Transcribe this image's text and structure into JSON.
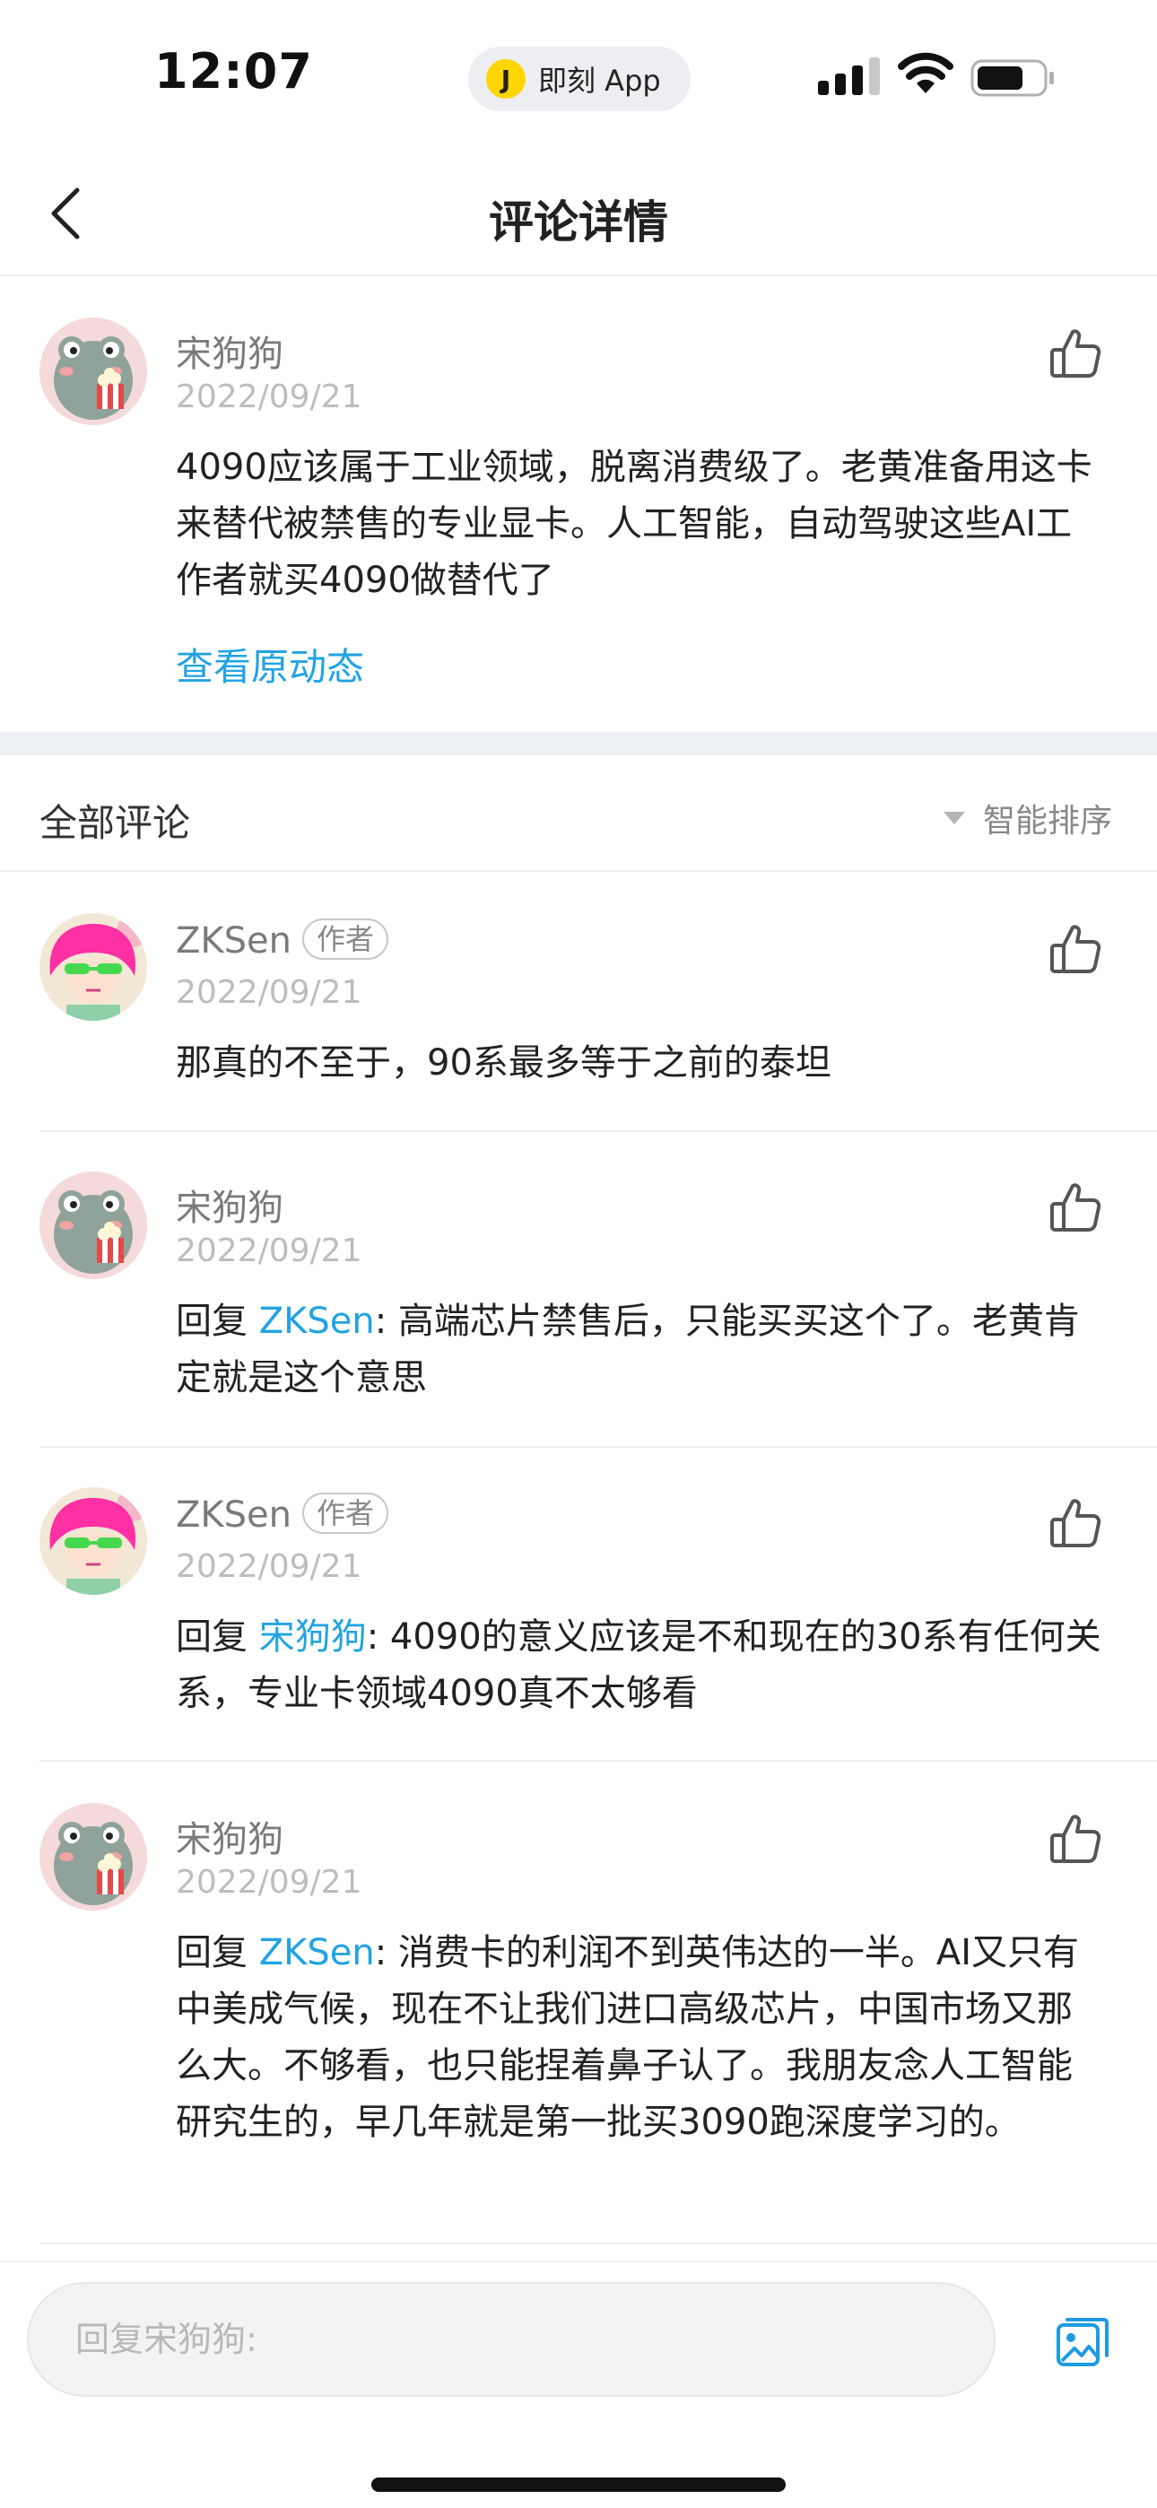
{
  "status_bar": {
    "time": "12:07",
    "app_pill": "即刻 App",
    "app_logo": "J"
  },
  "nav": {
    "title": "评论详情"
  },
  "main_comment": {
    "name": "宋狗狗",
    "date": "2022/09/21",
    "text": "4090应该属于工业领域，脱离消费级了。老黄准备用这卡来替代被禁售的专业显卡。人工智能，自动驾驶这些AI工作者就买4090做替代了",
    "view_origin": "查看原动态"
  },
  "section": {
    "title": "全部评论",
    "sort_label": "智能排序"
  },
  "comments": [
    {
      "name": "ZKSen",
      "badge": "作者",
      "date": "2022/09/21",
      "reply_prefix": "",
      "reply_to": "",
      "text": "那真的不至于，90系最多等于之前的泰坦"
    },
    {
      "name": "宋狗狗",
      "badge": "",
      "date": "2022/09/21",
      "reply_prefix": "回复 ",
      "reply_to": "ZKSen",
      "text": ": 高端芯片禁售后，只能买买这个了。老黄肯定就是这个意思"
    },
    {
      "name": "ZKSen",
      "badge": "作者",
      "date": "2022/09/21",
      "reply_prefix": "回复 ",
      "reply_to": "宋狗狗",
      "text": ": 4090的意义应该是不和现在的30系有任何关系，专业卡领域4090真不太够看"
    },
    {
      "name": "宋狗狗",
      "badge": "",
      "date": "2022/09/21",
      "reply_prefix": "回复 ",
      "reply_to": "ZKSen",
      "text": ": 消费卡的利润不到英伟达的一半。AI又只有中美成气候，现在不让我们进口高级芯片，中国市场又那么大。不够看，也只能捏着鼻子认了。我朋友念人工智能研究生的，早几年就是第一批买3090跑深度学习的。"
    }
  ],
  "reply_bar": {
    "placeholder": "回复宋狗狗:"
  },
  "colors": {
    "link": "#22a3e2",
    "divider": "#eeeeee",
    "section_gap": "#eef1f5"
  }
}
